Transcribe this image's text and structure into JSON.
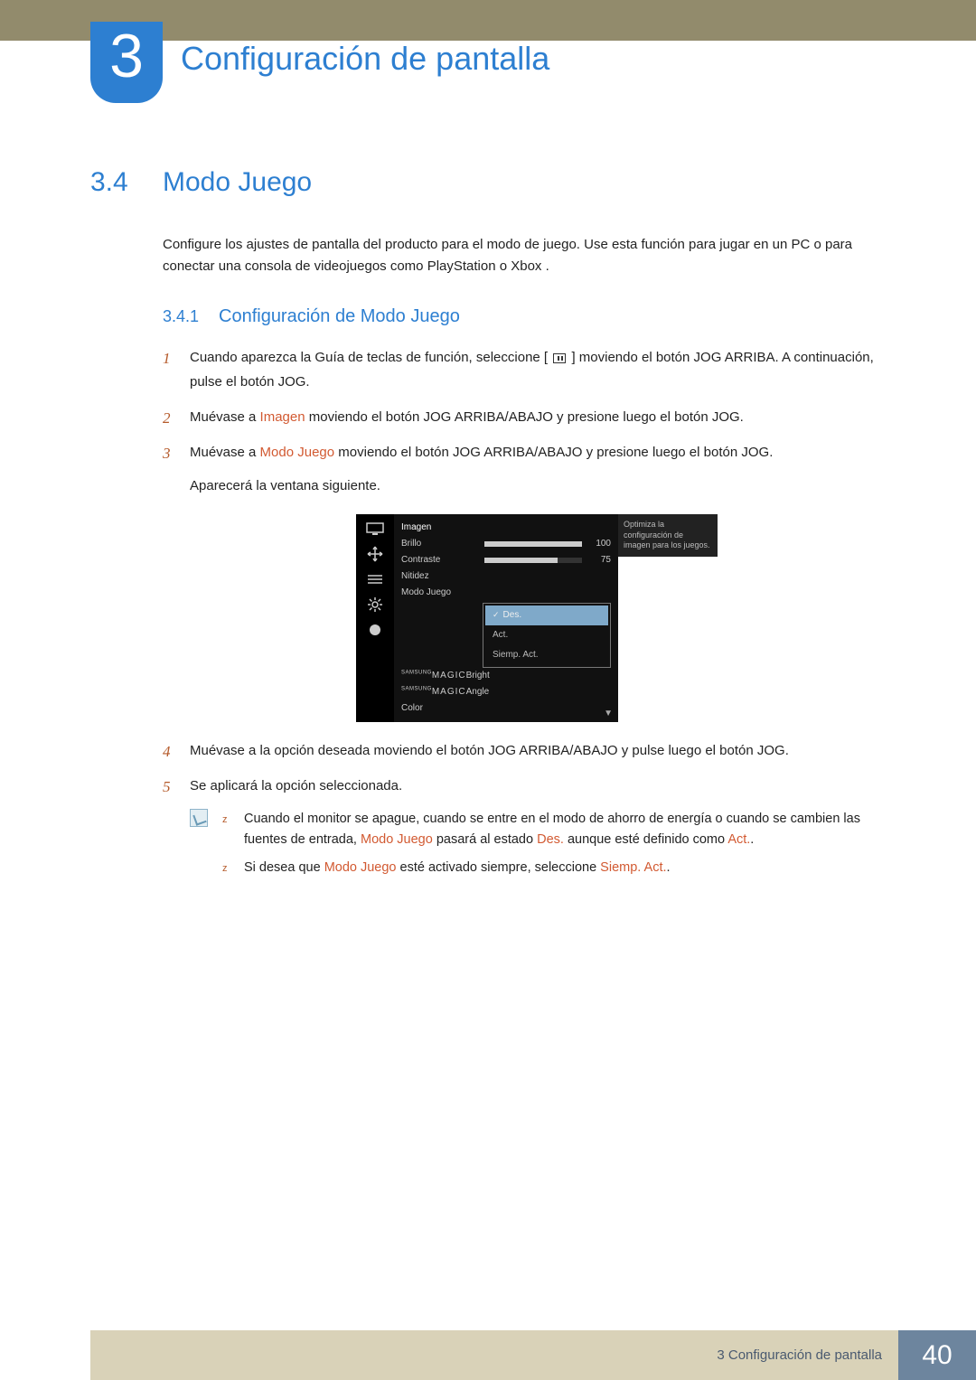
{
  "chapter": {
    "number": "3",
    "title": "Configuración de pantalla"
  },
  "section": {
    "number": "3.4",
    "title": "Modo Juego"
  },
  "lead": "Configure los ajustes de pantalla del producto para el modo de juego. Use esta función para jugar en un PC o para conectar una consola de videojuegos como PlayStation o Xbox .",
  "subsection": {
    "number": "3.4.1",
    "title": "Configuración de Modo Juego"
  },
  "steps": {
    "s1a": "Cuando aparezca la Guía de teclas de función, seleccione [",
    "s1b": "] moviendo el botón JOG ARRIBA. A continuación, pulse el botón JOG.",
    "s2a": "Muévase a ",
    "s2hl": "Imagen",
    "s2b": " moviendo el botón JOG ARRIBA/ABAJO y presione luego el botón JOG.",
    "s3a": "Muévase a ",
    "s3hl": "Modo Juego",
    "s3b": " moviendo el botón JOG ARRIBA/ABAJO y presione luego el botón JOG.",
    "s3c": "Aparecerá la ventana siguiente.",
    "s4": "Muévase a la opción deseada moviendo el botón JOG ARRIBA/ABAJO y pulse luego el botón JOG.",
    "s5": "Se aplicará la opción seleccionada."
  },
  "osd": {
    "header": "Imagen",
    "rows": [
      {
        "label": "Brillo",
        "value": 100,
        "fill": 100
      },
      {
        "label": "Contraste",
        "value": 75,
        "fill": 75
      }
    ],
    "nitidez": "Nitidez",
    "modo_juego": "Modo Juego",
    "magic_bright": "Bright",
    "magic_angle": "Angle",
    "color": "Color",
    "options": [
      "Des.",
      "Act.",
      "Siemp. Act."
    ],
    "selected": "Des.",
    "tooltip": "Optimiza la configuración de imagen para los juegos.",
    "magic_brand": "MAGIC",
    "magic_top": "SAMSUNG"
  },
  "notes": {
    "n1a": "Cuando el monitor se apague, cuando se entre en el modo de ahorro de energía o cuando se cambien las fuentes de entrada, ",
    "n1hl1": "Modo Juego",
    "n1b": " pasará al estado ",
    "n1hl2": "Des.",
    "n1c": " aunque esté definido como ",
    "n1hl3": "Act.",
    "n1d": ".",
    "n2a": "Si desea que ",
    "n2hl1": "Modo Juego",
    "n2b": " esté activado siempre, seleccione ",
    "n2hl2": "Siemp. Act.",
    "n2c": "."
  },
  "footer": {
    "chapter_ref": "3 Configuración de pantalla",
    "page": "40"
  }
}
